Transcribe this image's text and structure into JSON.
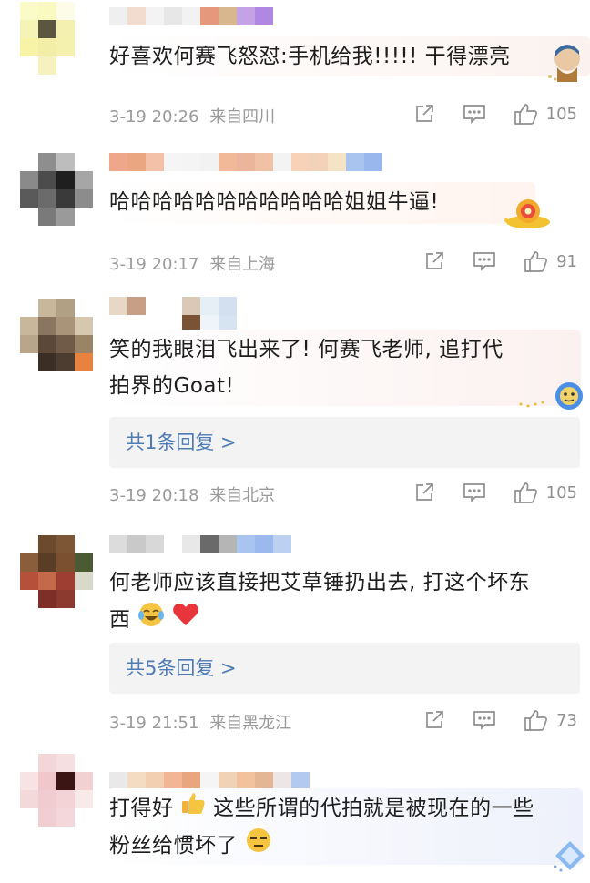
{
  "comments": [
    {
      "text": "好喜欢何赛飞怒怼:手机给我!!!!! 干得漂亮",
      "time": "3-19 20:26",
      "location": "来自四川",
      "likes": "105",
      "share_icon": "share-icon",
      "reply_icon": "comment-icon",
      "like_icon": "thumbs-up-icon"
    },
    {
      "text": "哈哈哈哈哈哈哈哈哈哈哈姐姐牛逼!",
      "time": "3-19 20:17",
      "location": "来自上海",
      "likes": "91"
    },
    {
      "text_line1": "笑的我眼泪飞出来了! 何赛飞老师, 追打代",
      "text_line2": "拍界的Goat!",
      "reply_summary": "共1条回复 >",
      "time": "3-19 20:18",
      "location": "来自北京",
      "likes": "105"
    },
    {
      "text_line1": "何老师应该直接把艾草锤扔出去, 打这个坏东",
      "text_line2": "西",
      "reply_summary": "共5条回复 >",
      "time": "3-19 21:51",
      "location": "来自黑龙江",
      "likes": "73"
    },
    {
      "text_line1a": "打得好",
      "text_line1b": "这些所谓的代拍就是被现在的一些",
      "text_line2": "粉丝给惯坏了"
    }
  ],
  "colors": {
    "meta": "#9a9a9a",
    "reply_link": "#4f7bb5",
    "reply_bg": "#f3f3f3",
    "heart": "#e8353b"
  }
}
